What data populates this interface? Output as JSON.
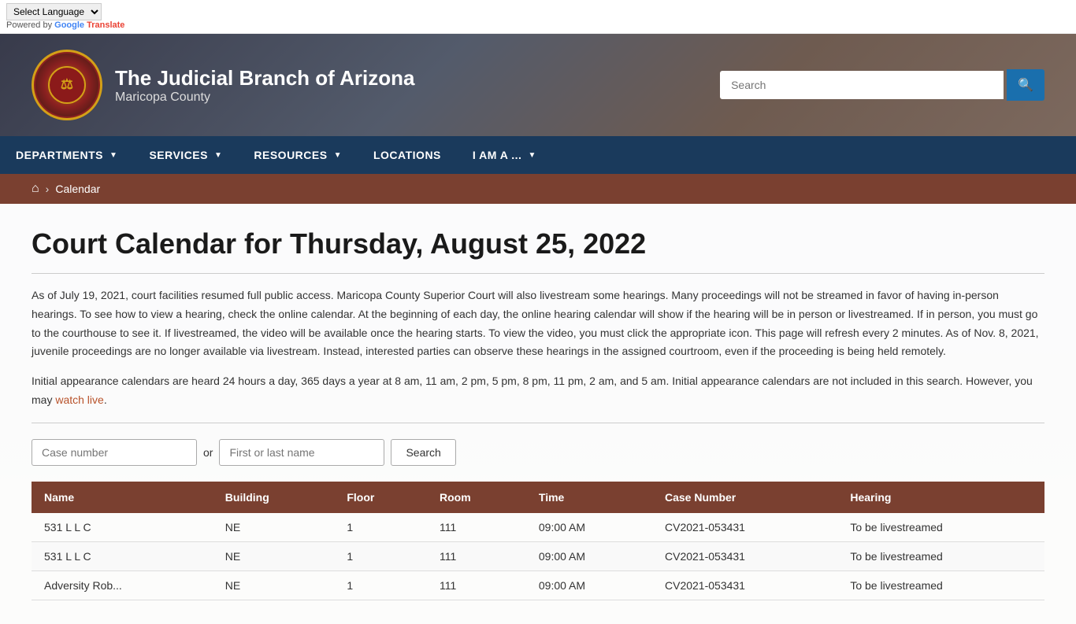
{
  "topbar": {
    "language_select_label": "Select Language",
    "powered_by": "Powered by",
    "google": "Google",
    "translate": "Translate"
  },
  "header": {
    "title": "The Judicial Branch of Arizona",
    "subtitle": "Maricopa County",
    "search_placeholder": "Search",
    "search_button_icon": "🔍"
  },
  "nav": {
    "items": [
      {
        "label": "DEPARTMENTS",
        "has_dropdown": true
      },
      {
        "label": "SERVICES",
        "has_dropdown": true
      },
      {
        "label": "RESOURCES",
        "has_dropdown": true
      },
      {
        "label": "LOCATIONS",
        "has_dropdown": false
      },
      {
        "label": "I AM A ...",
        "has_dropdown": true
      }
    ]
  },
  "breadcrumb": {
    "home_icon": "⌂",
    "separator": "›",
    "current": "Calendar"
  },
  "page": {
    "title": "Court Calendar for Thursday, August 25, 2022",
    "description1": "As of July 19, 2021, court facilities resumed full public access. Maricopa County Superior Court will also livestream some hearings. Many proceedings will not be streamed in favor of having in-person hearings. To see how to view a hearing, check the online calendar. At the beginning of each day, the online hearing calendar will show if the hearing will be in person or livestreamed. If in person, you must go to the courthouse to see it. If livestreamed, the video will be available once the hearing starts. To view the video, you must click the appropriate icon. This page will refresh every 2 minutes. As of Nov. 8, 2021, juvenile proceedings are no longer available via livestream. Instead, interested parties can observe these hearings in the assigned courtroom, even if the proceeding is being held remotely.",
    "description2_prefix": "Initial appearance calendars are heard 24 hours a day, 365 days a year at 8 am, 11 am, 2 pm, 5 pm, 8 pm, 11 pm, 2 am, and 5 am. Initial appearance calendars are not included in this search. However, you may ",
    "watch_live_link": "watch live",
    "description2_suffix": ".",
    "search": {
      "case_number_placeholder": "Case number",
      "or_label": "or",
      "name_placeholder": "First or last name",
      "button_label": "Search"
    },
    "table": {
      "columns": [
        "Name",
        "Building",
        "Floor",
        "Room",
        "Time",
        "Case Number",
        "Hearing"
      ],
      "rows": [
        {
          "name": "531 L L C",
          "building": "NE",
          "floor": "1",
          "room": "111",
          "time": "09:00 AM",
          "case_number": "CV2021-053431",
          "hearing": "To be livestreamed"
        },
        {
          "name": "531 L L C",
          "building": "NE",
          "floor": "1",
          "room": "111",
          "time": "09:00 AM",
          "case_number": "CV2021-053431",
          "hearing": "To be livestreamed"
        },
        {
          "name": "Adversity Rob...",
          "building": "NE",
          "floor": "1",
          "room": "111",
          "time": "09:00 AM",
          "case_number": "CV2021-053431",
          "hearing": "To be livestreamed"
        }
      ]
    }
  }
}
